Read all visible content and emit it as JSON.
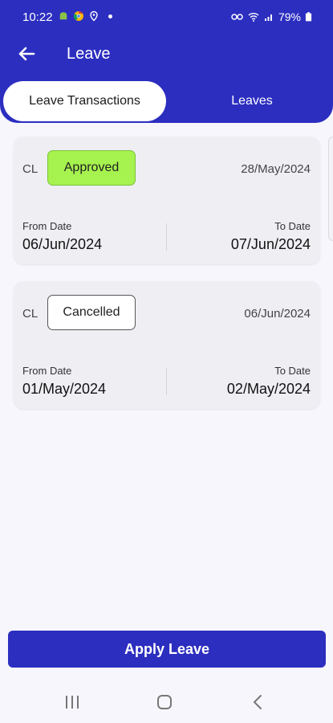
{
  "status_bar": {
    "time": "10:22",
    "battery": "79%"
  },
  "header": {
    "title": "Leave",
    "back_icon": "arrow-left-icon"
  },
  "tabs": [
    {
      "label": "Leave Transactions",
      "active": true
    },
    {
      "label": "Leaves",
      "active": false
    }
  ],
  "transactions": [
    {
      "type": "CL",
      "status": "Approved",
      "applied_date": "28/May/2024",
      "from_label": "From Date",
      "from_value": "06/Jun/2024",
      "to_label": "To Date",
      "to_value": "07/Jun/2024"
    },
    {
      "type": "CL",
      "status": "Cancelled",
      "applied_date": "06/Jun/2024",
      "from_label": "From Date",
      "from_value": "01/May/2024",
      "to_label": "To Date",
      "to_value": "02/May/2024"
    }
  ],
  "apply_button": {
    "label": "Apply Leave"
  },
  "colors": {
    "primary": "#2c2ec0",
    "approved": "#a6f24e",
    "background": "#f7f6fc",
    "card": "#efeef3"
  }
}
